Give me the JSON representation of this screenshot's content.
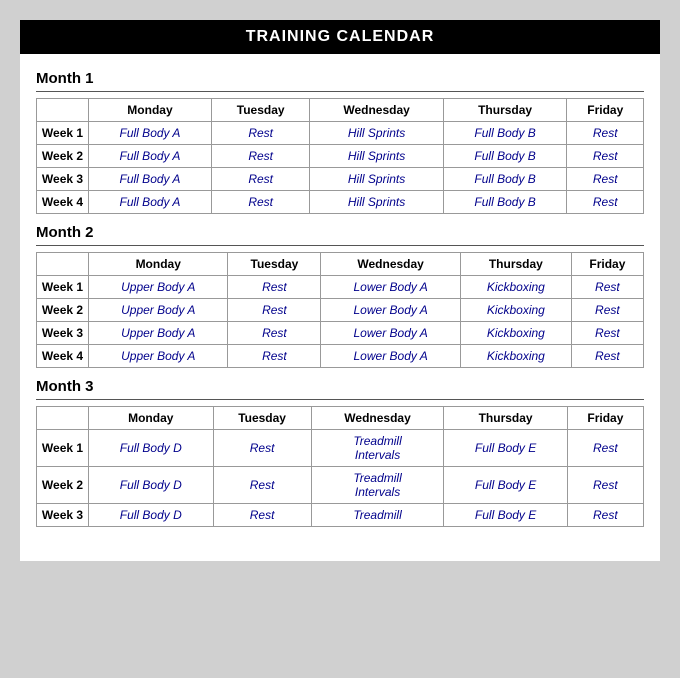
{
  "title": "TRAINING CALENDAR",
  "months": [
    {
      "label": "Month 1",
      "headers": [
        "",
        "Monday",
        "Tuesday",
        "Wednesday",
        "Thursday",
        "Friday"
      ],
      "weeks": [
        {
          "label": "Week 1",
          "days": [
            "Full Body A",
            "Rest",
            "Hill Sprints",
            "Full Body B",
            "Rest"
          ]
        },
        {
          "label": "Week 2",
          "days": [
            "Full Body A",
            "Rest",
            "Hill Sprints",
            "Full Body B",
            "Rest"
          ]
        },
        {
          "label": "Week 3",
          "days": [
            "Full Body A",
            "Rest",
            "Hill Sprints",
            "Full Body B",
            "Rest"
          ]
        },
        {
          "label": "Week 4",
          "days": [
            "Full Body A",
            "Rest",
            "Hill Sprints",
            "Full Body B",
            "Rest"
          ]
        }
      ]
    },
    {
      "label": "Month 2",
      "headers": [
        "",
        "Monday",
        "Tuesday",
        "Wednesday",
        "Thursday",
        "Friday"
      ],
      "weeks": [
        {
          "label": "Week 1",
          "days": [
            "Upper Body A",
            "Rest",
            "Lower Body A",
            "Kickboxing",
            "Rest"
          ]
        },
        {
          "label": "Week 2",
          "days": [
            "Upper Body A",
            "Rest",
            "Lower Body A",
            "Kickboxing",
            "Rest"
          ]
        },
        {
          "label": "Week 3",
          "days": [
            "Upper Body A",
            "Rest",
            "Lower Body A",
            "Kickboxing",
            "Rest"
          ]
        },
        {
          "label": "Week 4",
          "days": [
            "Upper Body A",
            "Rest",
            "Lower Body A",
            "Kickboxing",
            "Rest"
          ]
        }
      ]
    },
    {
      "label": "Month 3",
      "headers": [
        "",
        "Monday",
        "Tuesday",
        "Wednesday",
        "Thursday",
        "Friday"
      ],
      "weeks": [
        {
          "label": "Week 1",
          "days": [
            "Full Body D",
            "Rest",
            "Treadmill\nIntervals",
            "Full Body E",
            "Rest"
          ]
        },
        {
          "label": "Week 2",
          "days": [
            "Full Body D",
            "Rest",
            "Treadmill\nIntervals",
            "Full Body E",
            "Rest"
          ]
        },
        {
          "label": "Week 3",
          "days": [
            "Full Body D",
            "Rest",
            "Treadmill",
            "Full Body E",
            "Rest"
          ]
        }
      ]
    }
  ]
}
